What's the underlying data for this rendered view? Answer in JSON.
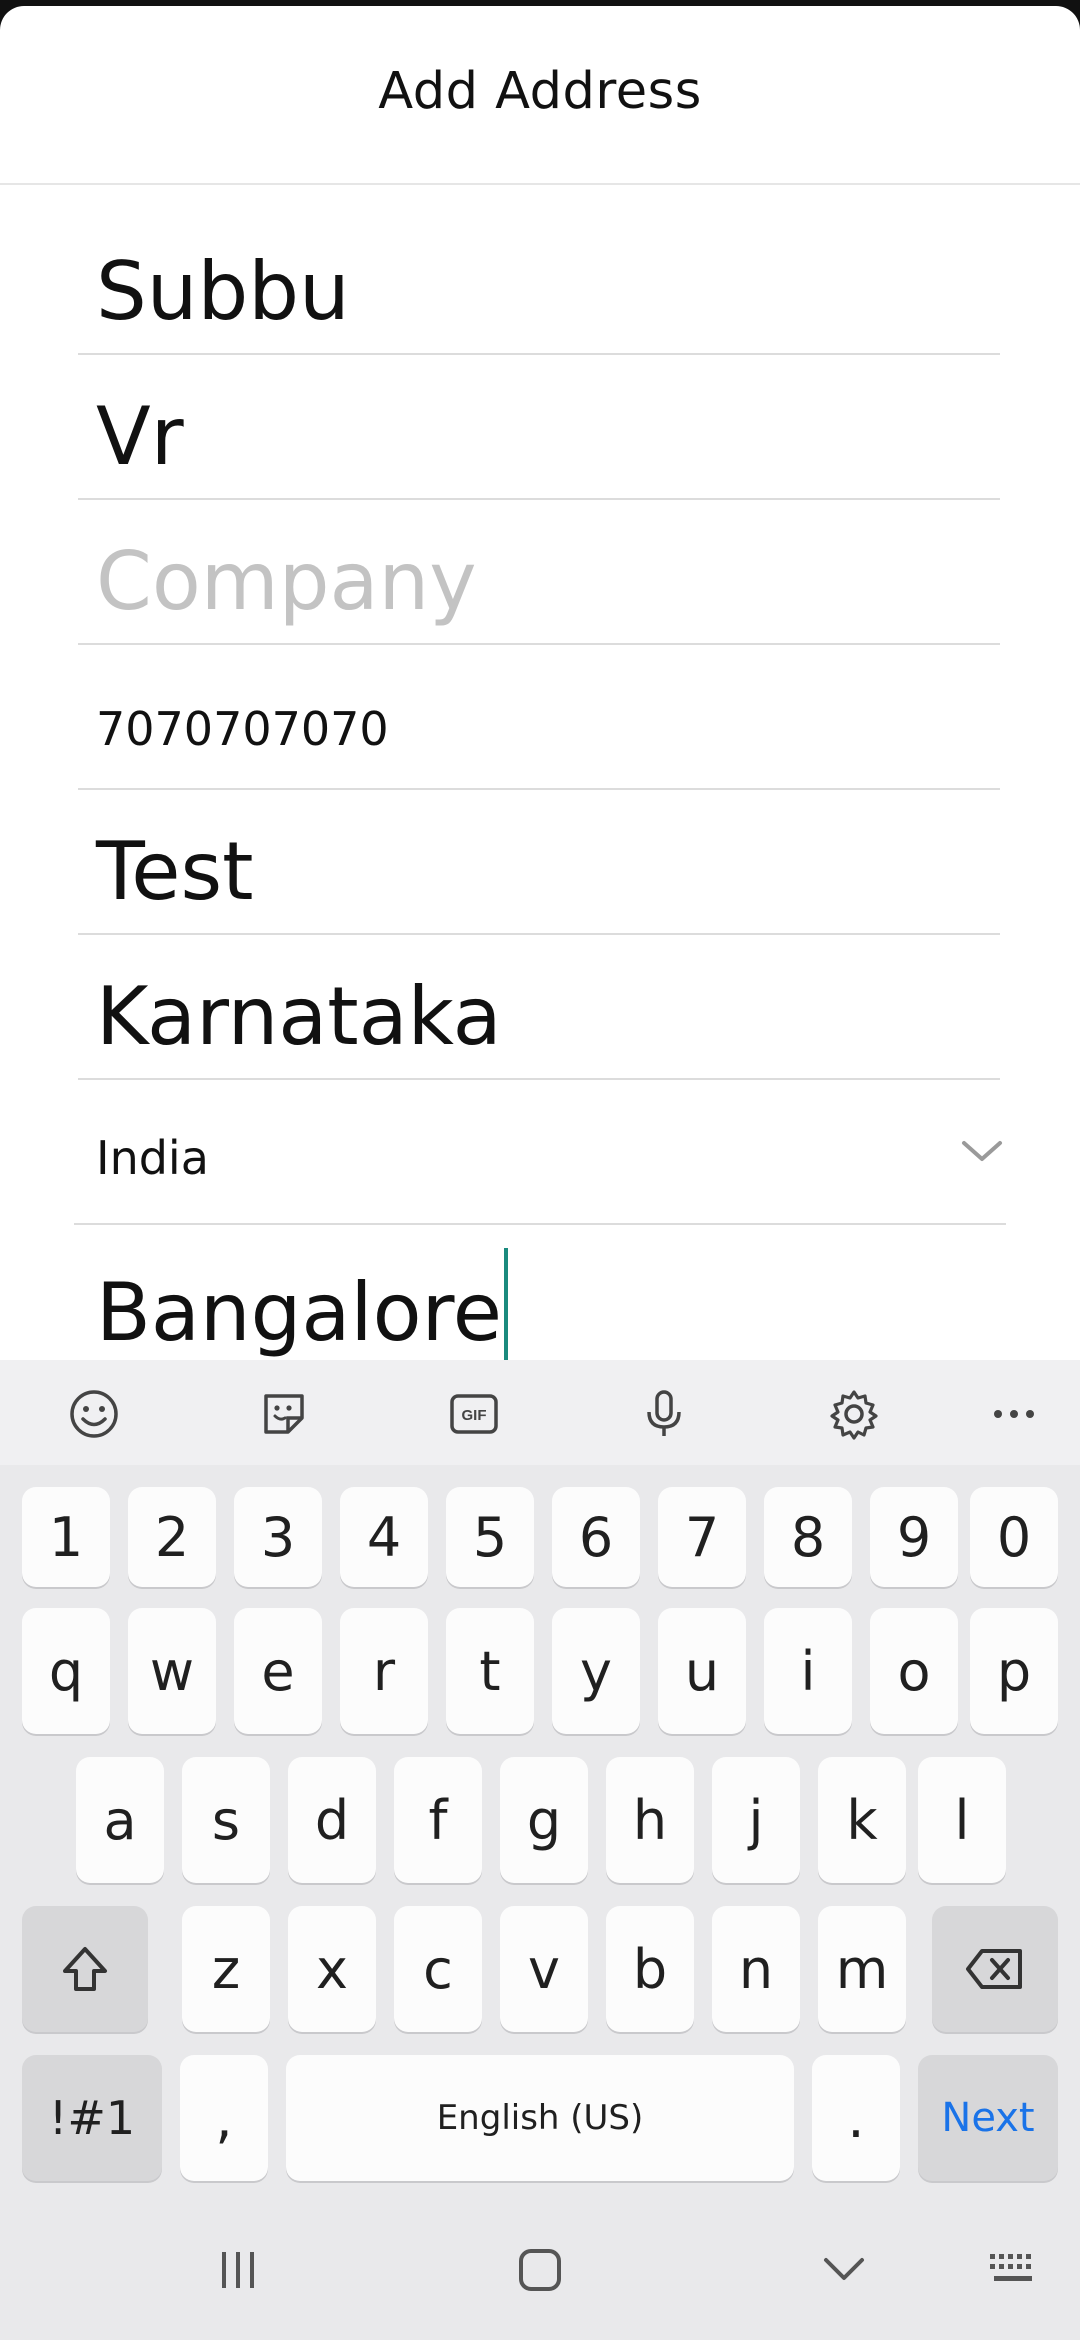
{
  "header": {
    "title": "Add Address"
  },
  "form": {
    "first_name": "Subbu",
    "last_name": "Vr",
    "company_placeholder": "Company",
    "phone": "7070707070",
    "address": "Test",
    "state": "Karnataka",
    "country": "India",
    "city": "Bangalore"
  },
  "keyboard": {
    "toolbar": [
      "emoji-icon",
      "sticker-icon",
      "gif-icon",
      "mic-icon",
      "settings-icon",
      "more-icon"
    ],
    "row_numbers": [
      "1",
      "2",
      "3",
      "4",
      "5",
      "6",
      "7",
      "8",
      "9",
      "0"
    ],
    "row_q": [
      "q",
      "w",
      "e",
      "r",
      "t",
      "y",
      "u",
      "i",
      "o",
      "p"
    ],
    "row_a": [
      "a",
      "s",
      "d",
      "f",
      "g",
      "h",
      "j",
      "k",
      "l"
    ],
    "row_z": [
      "z",
      "x",
      "c",
      "v",
      "b",
      "n",
      "m"
    ],
    "symbols_label": "!#1",
    "comma_label": ",",
    "space_label": "English (US)",
    "period_label": ".",
    "next_label": "Next",
    "accent_color": "#1a73e8"
  },
  "navbar": [
    "recents-icon",
    "home-icon",
    "back-chevron-icon",
    "keyboard-icon"
  ]
}
